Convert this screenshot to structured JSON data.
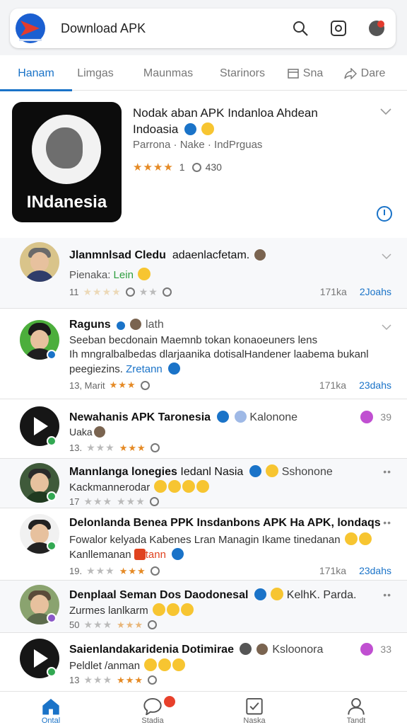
{
  "search": {
    "title": "Download APK"
  },
  "tabs": [
    {
      "label": "Hanam",
      "active": true
    },
    {
      "label": "Limgas"
    },
    {
      "label": "Maunmas"
    },
    {
      "label": "Starinors"
    },
    {
      "label": "Sna",
      "icon": "window-icon"
    },
    {
      "label": "Dare",
      "icon": "share-icon"
    }
  ],
  "featured": {
    "image_label": "INdanesia",
    "title": "Nodak aban APK Indanloa Ahdean Indoasia",
    "subtitle": "Parrona · Nake · IndPrguas",
    "rating_value": "1",
    "count": "430"
  },
  "items": [
    {
      "title": "Jlanmnlsad Cledu",
      "title_rest": "adaenlacfetam.",
      "line1": "Pienaka:",
      "line1_green": "Lein",
      "meta_left": "11",
      "right_num": "171ka",
      "right_blue": "2Joahs"
    },
    {
      "title": "Raguns",
      "title_rest": "lath",
      "line1": "Seeban becdonain Maemnb tokan konaoeuners lens",
      "line2": "Ih mngralbalbedas dlarjaanika dotisalHandener laabema bukanl",
      "line3": "peegiezins.",
      "line3_blue": "Zretann",
      "meta_left": "13, Marit",
      "right_num": "171ka",
      "right_blue": "23dahs"
    },
    {
      "title": "Newahanis APK Taronesia",
      "title_rest": "Kalonone",
      "line1": "Uaka",
      "meta_left": "13.",
      "top_right": "39"
    },
    {
      "title": "Mannlanga lonegies",
      "title_rest": "Iedanl Nasia",
      "title_tail": "Sshonone",
      "line1": "Kackmannerodar",
      "meta_left": "17",
      "top_right": "••"
    },
    {
      "title": "Delonlanda Benea PPK Insdanbons APK Ha APK, londaqs",
      "line1": "Fowalor kelyada Kabenes Lran Managin Ikame tinedanan",
      "line2": "Kanllemanan",
      "line2_tag": "tann",
      "meta_left": "19.",
      "right_num": "171ka",
      "right_blue": "23dahs",
      "top_right": "••"
    },
    {
      "title": "Denplaal Seman Dos Daodonesal",
      "title_tail": "KelhK. Parda.",
      "line1": "Zurmes lanlkarm",
      "meta_left": "50",
      "top_right": "••"
    },
    {
      "title": "Saienlandakaridenia Dotimirae",
      "title_tail": "Ksloonora",
      "line1": "Peldlet /anman",
      "meta_left": "13",
      "top_right": "33"
    }
  ],
  "bottom_nav": [
    {
      "label": "Ontal",
      "icon": "home-icon",
      "active": true
    },
    {
      "label": "Stadia",
      "icon": "chat-icon"
    },
    {
      "label": "Naska",
      "icon": "checklist-icon"
    },
    {
      "label": "Tandt",
      "icon": "profile-icon"
    }
  ],
  "colors": {
    "accent": "#1a73c8",
    "star": "#e58a25",
    "badge": "#e8402b"
  }
}
